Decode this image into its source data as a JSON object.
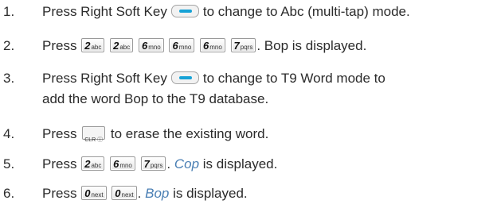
{
  "steps": [
    {
      "num": "1.",
      "a": "Press Right Soft Key",
      "b": "to change to Abc (multi-tap) mode."
    },
    {
      "num": "2.",
      "a": "Press",
      "b": ". Bop is displayed."
    },
    {
      "num": "3.",
      "a": "Press Right Soft Key",
      "b": "to change to T9 Word mode to",
      "c": "add the word Bop to the T9 database."
    },
    {
      "num": "4.",
      "a": "Press",
      "b": "to erase the existing word."
    },
    {
      "num": "5.",
      "a": "Press",
      "b": ". ",
      "word": "Cop",
      "c": " is displayed."
    },
    {
      "num": "6.",
      "a": "Press",
      "b": ". ",
      "word": "Bop",
      "c": " is displayed."
    }
  ],
  "keys": {
    "k2": {
      "big": "2",
      "small": "abc"
    },
    "k6": {
      "big": "6",
      "small": "mno"
    },
    "k7": {
      "big": "7",
      "small": "pqrs"
    },
    "k0": {
      "big": "0",
      "small": "next"
    },
    "clr": "CLR ⓘ"
  },
  "icons": {
    "softkey": "right-soft-key-icon",
    "clear": "clr-key-icon"
  },
  "colors": {
    "softkey_bar": "#17a2d6",
    "italic_word": "#4a7fb4"
  }
}
